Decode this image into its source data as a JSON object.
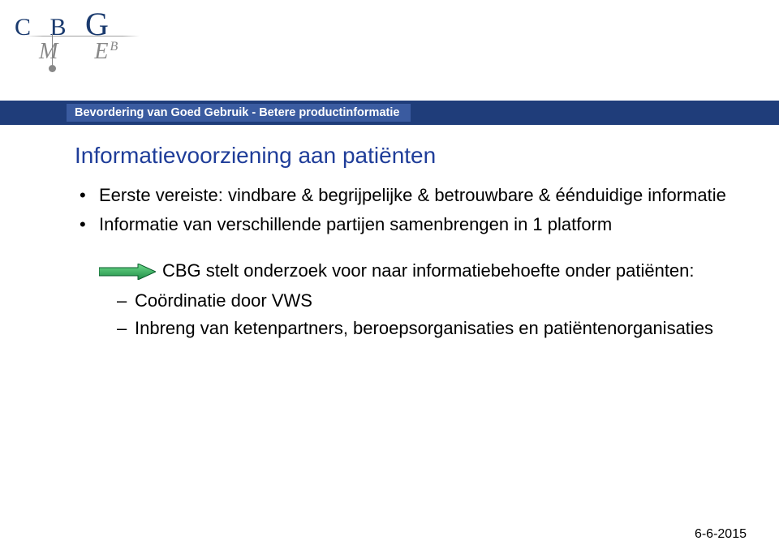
{
  "logo": {
    "top": "C B G",
    "sub": "M   E",
    "sup": "B"
  },
  "header_bar": "Bevordering van Goed Gebruik - Betere productinformatie",
  "title": "Informatievoorziening aan patiënten",
  "bullets": [
    "Eerste vereiste: vindbare & begrijpelijke & betrouwbare & éénduidige informatie",
    "Informatie van verschillende partijen samenbrengen in 1 platform"
  ],
  "arrow_text": "CBG stelt onderzoek voor naar informatiebehoefte onder patiënten:",
  "dashes": [
    "Coördinatie door VWS",
    "Inbreng van ketenpartners, beroepsorganisaties en patiëntenorganisaties"
  ],
  "date": "6-6-2015",
  "icons": {
    "arrow": "arrow-right"
  }
}
